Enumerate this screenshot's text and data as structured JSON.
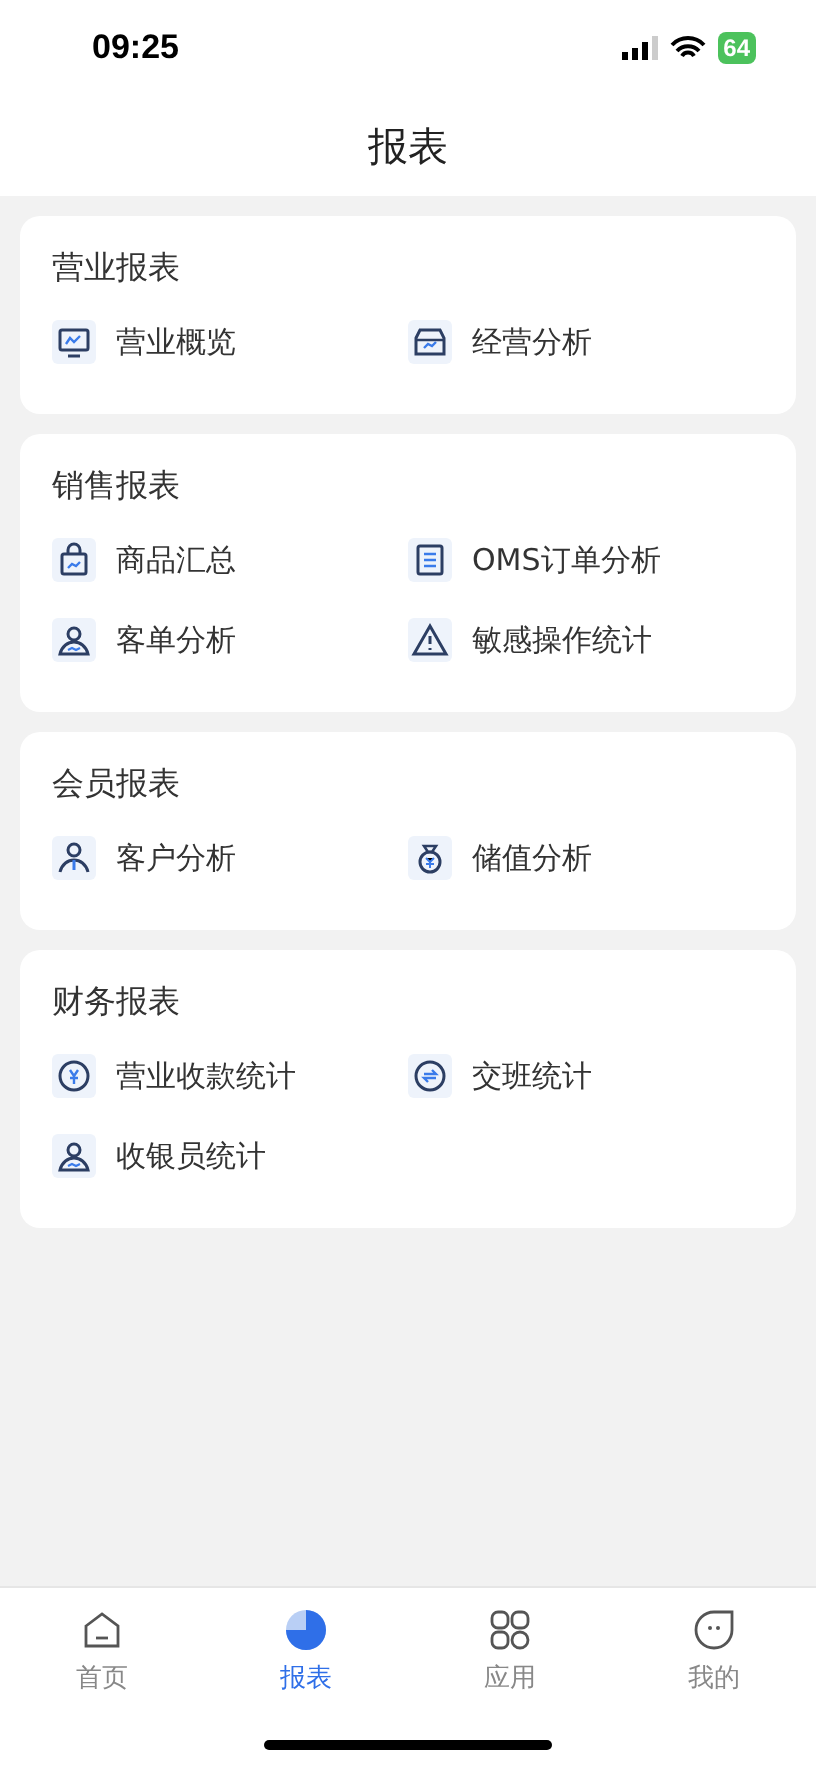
{
  "status_bar": {
    "time": "09:25",
    "battery": "64"
  },
  "header": {
    "title": "报表"
  },
  "sections": [
    {
      "title": "营业报表",
      "items": [
        {
          "label": "营业概览",
          "kind": "monitor"
        },
        {
          "label": "经营分析",
          "kind": "store"
        }
      ]
    },
    {
      "title": "销售报表",
      "items": [
        {
          "label": "商品汇总",
          "kind": "bag"
        },
        {
          "label": "OMS订单分析",
          "kind": "document"
        },
        {
          "label": "客单分析",
          "kind": "person"
        },
        {
          "label": "敏感操作统计",
          "kind": "warning"
        }
      ]
    },
    {
      "title": "会员报表",
      "items": [
        {
          "label": "客户分析",
          "kind": "member"
        },
        {
          "label": "储值分析",
          "kind": "moneybag"
        }
      ]
    },
    {
      "title": "财务报表",
      "items": [
        {
          "label": "营业收款统计",
          "kind": "yen"
        },
        {
          "label": "交班统计",
          "kind": "exchange"
        },
        {
          "label": "收银员统计",
          "kind": "person"
        }
      ]
    }
  ],
  "tab_bar": [
    {
      "label": "首页",
      "kind": "home",
      "selected": false
    },
    {
      "label": "报表",
      "kind": "chart",
      "selected": true
    },
    {
      "label": "应用",
      "kind": "grid",
      "selected": false
    },
    {
      "label": "我的",
      "kind": "face",
      "selected": false
    }
  ]
}
